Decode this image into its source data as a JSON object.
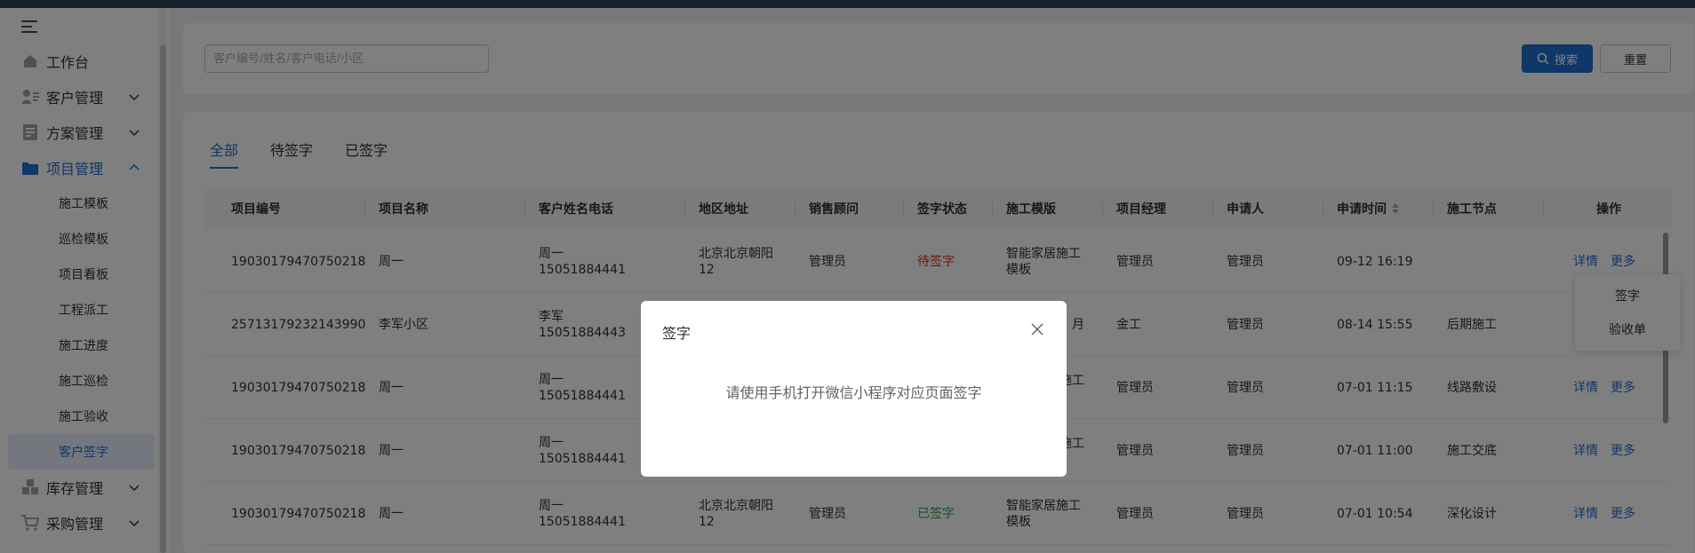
{
  "sidebar": {
    "items": [
      {
        "label": "工作台",
        "icon": "home-icon"
      },
      {
        "label": "客户管理",
        "icon": "customer-icon"
      },
      {
        "label": "方案管理",
        "icon": "document-icon"
      },
      {
        "label": "项目管理",
        "icon": "folder-icon"
      },
      {
        "label": "库存管理",
        "icon": "warehouse-icon"
      },
      {
        "label": "采购管理",
        "icon": "cart-icon"
      }
    ],
    "sub_items": [
      "施工模板",
      "巡检模板",
      "项目看板",
      "工程派工",
      "施工进度",
      "施工巡检",
      "施工验收",
      "客户签字"
    ],
    "active_item": "项目管理",
    "selected_sub": "客户签字"
  },
  "search": {
    "placeholder": "客户编号/姓名/客户电话/小区",
    "value": "",
    "search_label": "搜索",
    "reset_label": "重置"
  },
  "tabs": [
    {
      "label": "全部",
      "active": true
    },
    {
      "label": "待签字",
      "active": false
    },
    {
      "label": "已签字",
      "active": false
    }
  ],
  "table": {
    "headers": [
      "项目编号",
      "项目名称",
      "客户姓名电话",
      "地区地址",
      "销售顾问",
      "签字状态",
      "施工模版",
      "项目经理",
      "申请人",
      "申请时间",
      "施工节点",
      "操作"
    ],
    "rows": [
      {
        "code": "19030179470750218",
        "name": "周一",
        "cust_name": "周一",
        "cust_phone": "15051884441",
        "region_1": "北京北京朝阳",
        "region_2": "12",
        "sales": "管理员",
        "status": "待签字",
        "tpl_1": "智能家居施工",
        "tpl_2": "模板",
        "manager": "管理员",
        "applicant": "管理员",
        "time": "09-12 16:19",
        "node": "",
        "op_detail": "详情",
        "op_more": "更多"
      },
      {
        "code": "25713179232143990",
        "name": "李军小区",
        "cust_name": "李军",
        "cust_phone": "15051884443",
        "region_1": "",
        "region_2": "",
        "sales": "",
        "status": "",
        "tpl_1": "月",
        "tpl_2": "",
        "manager": "金工",
        "applicant": "管理员",
        "time": "08-14 15:55",
        "node": "后期施工",
        "op_detail": "",
        "op_more": ""
      },
      {
        "code": "19030179470750218",
        "name": "周一",
        "cust_name": "周一",
        "cust_phone": "15051884441",
        "region_1": "",
        "region_2": "",
        "sales": "",
        "status": "",
        "tpl_1": "施工",
        "tpl_2": "",
        "manager": "管理员",
        "applicant": "管理员",
        "time": "07-01 11:15",
        "node": "线路敷设",
        "op_detail": "详情",
        "op_more": "更多"
      },
      {
        "code": "19030179470750218",
        "name": "周一",
        "cust_name": "周一",
        "cust_phone": "15051884441",
        "region_1": "",
        "region_2": "",
        "sales": "",
        "status": "",
        "tpl_1": "施工",
        "tpl_2": "",
        "manager": "管理员",
        "applicant": "管理员",
        "time": "07-01 11:00",
        "node": "施工交底",
        "op_detail": "详情",
        "op_more": "更多"
      },
      {
        "code": "19030179470750218",
        "name": "周一",
        "cust_name": "周一",
        "cust_phone": "15051884441",
        "region_1": "北京北京朝阳",
        "region_2": "12",
        "sales": "管理员",
        "status": "已签字",
        "tpl_1": "智能家居施工",
        "tpl_2": "模板",
        "manager": "管理员",
        "applicant": "管理员",
        "time": "07-01 10:54",
        "node": "深化设计",
        "op_detail": "详情",
        "op_more": "更多"
      }
    ]
  },
  "dropdown": {
    "items": [
      "签字",
      "验收单"
    ]
  },
  "modal": {
    "title": "签字",
    "body": "请使用手机打开微信小程序对应页面签字"
  },
  "colors": {
    "primary": "#1f6fd1",
    "pending": "#d9342b",
    "signed": "#2e9e4e",
    "topbar": "#304156"
  }
}
